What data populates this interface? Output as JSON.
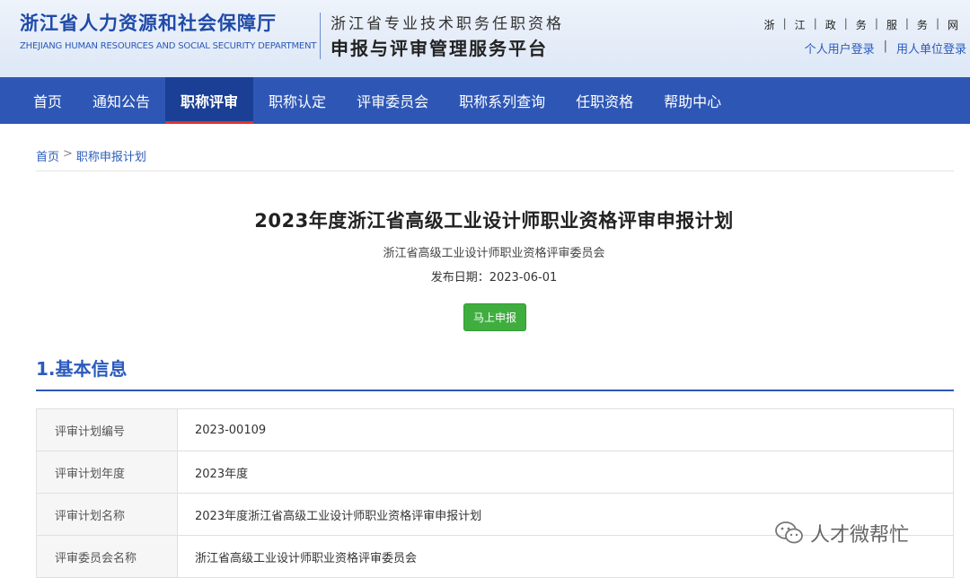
{
  "header": {
    "org_title": "浙江省人力资源和社会保障厅",
    "org_en": "ZHEJIANG HUMAN RESOURCES AND SOCIAL SECURITY DEPARTMENT",
    "platform_line1": "浙江省专业技术职务任职资格",
    "platform_line2": "申报与评审管理服务平台",
    "gov_links": [
      "浙",
      "江",
      "政",
      "务",
      "服",
      "务",
      "网"
    ],
    "login_personal": "个人用户登录",
    "login_separator": "|",
    "login_employer": "用人单位登录"
  },
  "nav": {
    "items": [
      "首页",
      "通知公告",
      "职称评审",
      "职称认定",
      "评审委员会",
      "职称系列查询",
      "任职资格",
      "帮助中心"
    ],
    "active_index": 2
  },
  "breadcrumb": {
    "home": "首页",
    "separator": ">",
    "current": "职称申报计划"
  },
  "document": {
    "title": "2023年度浙江省高级工业设计师职业资格评审申报计划",
    "committee": "浙江省高级工业设计师职业资格评审委员会",
    "date_label": "发布日期：",
    "date_value": "2023-06-01",
    "apply_button": "马上申报"
  },
  "section": {
    "title": "1.基本信息"
  },
  "info_table": {
    "rows": [
      {
        "label": "评审计划编号",
        "value": "2023-00109"
      },
      {
        "label": "评审计划年度",
        "value": "2023年度"
      },
      {
        "label": "评审计划名称",
        "value": "2023年度浙江省高级工业设计师职业资格评审申报计划"
      },
      {
        "label": "评审委员会名称",
        "value": "浙江省高级工业设计师职业资格评审委员会"
      }
    ]
  },
  "watermark": {
    "text": "人才微帮忙",
    "icon": "wechat-icon"
  },
  "colors": {
    "nav_bg": "#2e57b5",
    "nav_active_bg": "#1b3f94",
    "active_indicator": "#e0322b",
    "brand_blue": "#2a5bbd",
    "apply_green": "#3fae3f"
  }
}
